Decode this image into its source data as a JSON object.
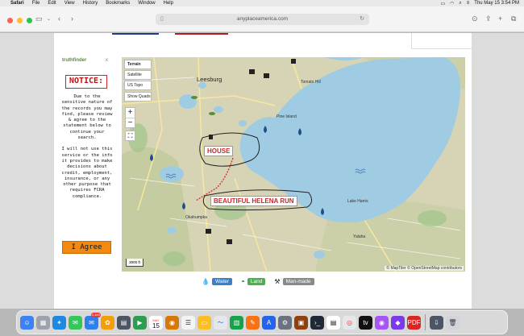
{
  "menubar": {
    "app": "Safari",
    "items": [
      "File",
      "Edit",
      "View",
      "History",
      "Bookmarks",
      "Window",
      "Help"
    ],
    "datetime": "Thu May 15  3:54 PM"
  },
  "browser": {
    "url": "anyplaceamerica.com"
  },
  "ad": {
    "brand": "truthfinder",
    "close": "x",
    "notice": "NOTICE:",
    "paragraph1": "Due to the sensitive nature of the records you may find, please review & agree to the statement below to continue your search.",
    "paragraph2": "I will not use this service or the info it provides to make decisions about credit, employment, insurance, or any other purpose that requires FCRA compliance.",
    "button": "I Agree"
  },
  "map": {
    "layers": [
      "Terrain",
      "Satellite",
      "US Topo"
    ],
    "show_quads": "Show Quads",
    "zoom_in": "+",
    "zoom_out": "−",
    "scale": "3000 ft",
    "attribution": "© MapTiler © OpenStreetMap contributors",
    "places": {
      "leesburg": "Leesburg",
      "lake_harris": "Lake Harris",
      "okahumpka": "Okahumpka",
      "yalaha": "Yalaha",
      "pine_island": "Pine Island",
      "tomato_hill": "Tomato Hill"
    },
    "annotations": {
      "house": "HOUSE",
      "run": "BEAUTIFUL HELENA RUN"
    }
  },
  "legend": {
    "water": "Water",
    "land": "Land",
    "manmade": "Man-made",
    "colors": {
      "water": "#3a7fc8",
      "land": "#4caf50",
      "manmade": "#8a8a8a"
    }
  },
  "dock": {
    "mail_badge": "2,443",
    "calendar_month": "MAY",
    "calendar_day": "15"
  }
}
